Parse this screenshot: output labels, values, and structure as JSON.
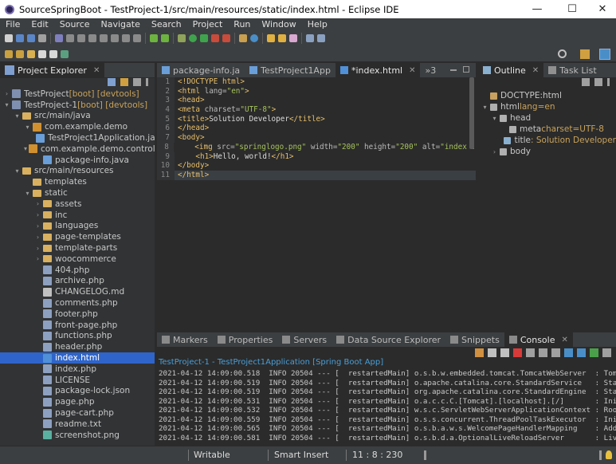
{
  "window": {
    "title": "SourceSpringBoot - TestProject-1/src/main/resources/static/index.html - Eclipse IDE",
    "minimize": "—",
    "maximize": "☐",
    "close": "✕"
  },
  "menu": [
    "File",
    "Edit",
    "Source",
    "Navigate",
    "Search",
    "Project",
    "Run",
    "Window",
    "Help"
  ],
  "explorer": {
    "tab_label": "Project Explorer",
    "tree": [
      {
        "label": "TestProject",
        "decoration": "[boot] [devtools]",
        "depth": 0,
        "expanded": false,
        "icon": "project-icon"
      },
      {
        "label": "TestProject-1",
        "decoration": "[boot] [devtools]",
        "depth": 0,
        "expanded": true,
        "icon": "project-icon"
      },
      {
        "label": "src/main/java",
        "decoration": "",
        "depth": 1,
        "expanded": true,
        "icon": "source-folder-icon"
      },
      {
        "label": "com.example.demo",
        "decoration": "",
        "depth": 2,
        "expanded": true,
        "icon": "package-icon"
      },
      {
        "label": "TestProject1Application.java",
        "decoration": "",
        "depth": 3,
        "expanded": null,
        "icon": "java-file-icon"
      },
      {
        "label": "com.example.demo.controller",
        "decoration": "",
        "depth": 2,
        "expanded": true,
        "icon": "package-icon"
      },
      {
        "label": "package-info.java",
        "decoration": "",
        "depth": 3,
        "expanded": null,
        "icon": "java-file-icon"
      },
      {
        "label": "src/main/resources",
        "decoration": "",
        "depth": 1,
        "expanded": true,
        "icon": "source-folder-icon"
      },
      {
        "label": "templates",
        "decoration": "",
        "depth": 2,
        "expanded": null,
        "icon": "folder-icon"
      },
      {
        "label": "static",
        "decoration": "",
        "depth": 2,
        "expanded": true,
        "icon": "folder-icon"
      },
      {
        "label": "assets",
        "decoration": "",
        "depth": 3,
        "expanded": false,
        "icon": "folder-icon"
      },
      {
        "label": "inc",
        "decoration": "",
        "depth": 3,
        "expanded": false,
        "icon": "folder-icon"
      },
      {
        "label": "languages",
        "decoration": "",
        "depth": 3,
        "expanded": false,
        "icon": "folder-icon"
      },
      {
        "label": "page-templates",
        "decoration": "",
        "depth": 3,
        "expanded": false,
        "icon": "folder-icon"
      },
      {
        "label": "template-parts",
        "decoration": "",
        "depth": 3,
        "expanded": false,
        "icon": "folder-icon"
      },
      {
        "label": "woocommerce",
        "decoration": "",
        "depth": 3,
        "expanded": false,
        "icon": "folder-icon"
      },
      {
        "label": "404.php",
        "decoration": "",
        "depth": 3,
        "expanded": null,
        "icon": "file-icon"
      },
      {
        "label": "archive.php",
        "decoration": "",
        "depth": 3,
        "expanded": null,
        "icon": "file-icon"
      },
      {
        "label": "CHANGELOG.md",
        "decoration": "",
        "depth": 3,
        "expanded": null,
        "icon": "markdown-file-icon"
      },
      {
        "label": "comments.php",
        "decoration": "",
        "depth": 3,
        "expanded": null,
        "icon": "file-icon"
      },
      {
        "label": "footer.php",
        "decoration": "",
        "depth": 3,
        "expanded": null,
        "icon": "file-icon"
      },
      {
        "label": "front-page.php",
        "decoration": "",
        "depth": 3,
        "expanded": null,
        "icon": "file-icon"
      },
      {
        "label": "functions.php",
        "decoration": "",
        "depth": 3,
        "expanded": null,
        "icon": "file-icon"
      },
      {
        "label": "header.php",
        "decoration": "",
        "depth": 3,
        "expanded": null,
        "icon": "file-icon"
      },
      {
        "label": "index.html",
        "decoration": "",
        "depth": 3,
        "expanded": null,
        "icon": "html-file-icon",
        "selected": true
      },
      {
        "label": "index.php",
        "decoration": "",
        "depth": 3,
        "expanded": null,
        "icon": "file-icon"
      },
      {
        "label": "LICENSE",
        "decoration": "",
        "depth": 3,
        "expanded": null,
        "icon": "file-icon"
      },
      {
        "label": "package-lock.json",
        "decoration": "",
        "depth": 3,
        "expanded": null,
        "icon": "file-icon"
      },
      {
        "label": "page.php",
        "decoration": "",
        "depth": 3,
        "expanded": null,
        "icon": "file-icon"
      },
      {
        "label": "page-cart.php",
        "decoration": "",
        "depth": 3,
        "expanded": null,
        "icon": "file-icon"
      },
      {
        "label": "readme.txt",
        "decoration": "",
        "depth": 3,
        "expanded": null,
        "icon": "file-icon"
      },
      {
        "label": "screenshot.png",
        "decoration": "",
        "depth": 3,
        "expanded": null,
        "icon": "image-file-icon"
      }
    ]
  },
  "editor": {
    "tabs": [
      {
        "label": "package-info.ja",
        "active": false
      },
      {
        "label": "TestProject1App",
        "active": false
      },
      {
        "label": "*index.html",
        "active": true
      }
    ],
    "overflow": "»3",
    "lines": [
      [
        {
          "c": "tag",
          "t": "<!DOCTYPE html>"
        }
      ],
      [
        {
          "c": "tag",
          "t": "<html "
        },
        {
          "c": "attr",
          "t": "lang="
        },
        {
          "c": "val",
          "t": "\"en\""
        },
        {
          "c": "tag",
          "t": ">"
        }
      ],
      [
        {
          "c": "tag",
          "t": "<head>"
        }
      ],
      [
        {
          "c": "tag",
          "t": "<meta "
        },
        {
          "c": "attr",
          "t": "charset="
        },
        {
          "c": "val",
          "t": "\"UTF-8\""
        },
        {
          "c": "tag",
          "t": ">"
        }
      ],
      [
        {
          "c": "tag",
          "t": "<title>"
        },
        {
          "c": "txt",
          "t": "Solution Developer"
        },
        {
          "c": "tag",
          "t": "</title>"
        }
      ],
      [
        {
          "c": "tag",
          "t": "</head>"
        }
      ],
      [
        {
          "c": "tag",
          "t": "<body>"
        }
      ],
      [
        {
          "c": "txt",
          "t": "    "
        },
        {
          "c": "tag",
          "t": "<img "
        },
        {
          "c": "attr",
          "t": "src="
        },
        {
          "c": "val",
          "t": "\"springlogo.png\""
        },
        {
          "c": "attr",
          "t": " width="
        },
        {
          "c": "val",
          "t": "\"200\""
        },
        {
          "c": "attr",
          "t": " height="
        },
        {
          "c": "val",
          "t": "\"200\""
        },
        {
          "c": "attr",
          "t": " alt="
        },
        {
          "c": "val",
          "t": "\"index :"
        }
      ],
      [
        {
          "c": "txt",
          "t": "    "
        },
        {
          "c": "tag",
          "t": "<h1>"
        },
        {
          "c": "txt",
          "t": "Hello, world!"
        },
        {
          "c": "tag",
          "t": "</h1>"
        }
      ],
      [
        {
          "c": "tag",
          "t": "</body>"
        }
      ],
      [
        {
          "c": "tag",
          "t": "</html>"
        }
      ]
    ],
    "fold_markers": [
      "",
      "⊖",
      "⊖",
      "",
      "",
      "",
      "⊖",
      "",
      "",
      "",
      ""
    ]
  },
  "outline": {
    "tabs": [
      {
        "label": "Outline",
        "active": true
      },
      {
        "label": "Task List",
        "active": false
      }
    ],
    "nodes": [
      {
        "label": "DOCTYPE:html",
        "extra": "",
        "depth": 0,
        "twisty": ""
      },
      {
        "label": "html",
        "extra": "lang=en",
        "depth": 0,
        "twisty": "▾"
      },
      {
        "label": "head",
        "extra": "",
        "depth": 1,
        "twisty": "▾"
      },
      {
        "label": "meta",
        "extra": "charset=UTF-8",
        "depth": 2,
        "twisty": ""
      },
      {
        "label": "title",
        "extra": ": Solution Developer",
        "depth": 2,
        "twisty": ""
      },
      {
        "label": "body",
        "extra": "",
        "depth": 1,
        "twisty": "›"
      }
    ]
  },
  "console": {
    "tabs": [
      {
        "label": "Markers",
        "active": false
      },
      {
        "label": "Properties",
        "active": false
      },
      {
        "label": "Servers",
        "active": false
      },
      {
        "label": "Data Source Explorer",
        "active": false
      },
      {
        "label": "Snippets",
        "active": false
      },
      {
        "label": "Console",
        "active": true
      }
    ],
    "header": "TestProject-1 - TestProject1Application [Spring Boot App]",
    "log": [
      "2021-04-12 14:09:00.518  INFO 20504 --- [  restartedMain] o.s.b.w.embedded.tomcat.TomcatWebServer  : Tomca",
      "2021-04-12 14:09:00.519  INFO 20504 --- [  restartedMain] o.apache.catalina.core.StandardService   : Start",
      "2021-04-12 14:09:00.519  INFO 20504 --- [  restartedMain] org.apache.catalina.core.StandardEngine  : Start",
      "2021-04-12 14:09:00.531  INFO 20504 --- [  restartedMain] o.a.c.c.C.[Tomcat].[localhost].[/]       : Initi",
      "2021-04-12 14:09:00.532  INFO 20504 --- [  restartedMain] w.s.c.ServletWebServerApplicationContext : Root",
      "2021-04-12 14:09:00.559  INFO 20504 --- [  restartedMain] o.s.s.concurrent.ThreadPoolTaskExecutor  : Initi",
      "2021-04-12 14:09:00.565  INFO 20504 --- [  restartedMain] o.s.b.a.w.s.WelcomePageHandlerMapping    : Addin",
      "2021-04-12 14:09:00.581  INFO 20504 --- [  restartedMain] o.s.b.d.a.OptionalLiveReloadServer       : LiveR"
    ]
  },
  "status": {
    "mode": "Writable",
    "insert": "Smart Insert",
    "position": "11 : 8 : 230"
  },
  "colors": {
    "accent": "#2f65ca",
    "console_header": "#4a9ed6"
  }
}
